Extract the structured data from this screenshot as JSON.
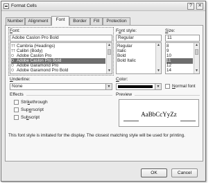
{
  "window": {
    "title": "Format Cells",
    "help_label": "?",
    "close_label": "✕",
    "icon": "excel-app-icon"
  },
  "tabs": [
    {
      "label": "Number",
      "active": false
    },
    {
      "label": "Alignment",
      "active": false
    },
    {
      "label": "Font",
      "active": true
    },
    {
      "label": "Border",
      "active": false
    },
    {
      "label": "Fill",
      "active": false
    },
    {
      "label": "Protection",
      "active": false
    }
  ],
  "font": {
    "label_mnemonic": "F",
    "label_rest": "ont:",
    "value": "Adobe Caslon Pro Bold",
    "list": [
      {
        "label": "Cambria (Headings)",
        "icon": "truetype-font-icon",
        "selected": false
      },
      {
        "label": "Calibri (Body)",
        "icon": "truetype-font-icon",
        "selected": false
      },
      {
        "label": "Adobe Caslon Pro",
        "icon": "opentype-font-icon",
        "selected": false
      },
      {
        "label": "Adobe Caslon Pro Bold",
        "icon": "opentype-font-icon",
        "selected": true
      },
      {
        "label": "Adobe Garamond Pro",
        "icon": "opentype-font-icon",
        "selected": false
      },
      {
        "label": "Adobe Garamond Pro Bold",
        "icon": "opentype-font-icon",
        "selected": false
      }
    ]
  },
  "font_style": {
    "label_mnemonic": "o",
    "label_pre": "F",
    "label_rest": "nt style:",
    "value": "Regular",
    "list": [
      {
        "label": "Regular",
        "selected": true
      },
      {
        "label": "Italic",
        "selected": false
      },
      {
        "label": "Bold",
        "selected": false
      },
      {
        "label": "Bold Italic",
        "selected": false
      }
    ]
  },
  "size": {
    "label_mnemonic": "S",
    "label_rest": "ize:",
    "value": "11",
    "list": [
      {
        "label": "8",
        "selected": false
      },
      {
        "label": "9",
        "selected": false
      },
      {
        "label": "10",
        "selected": false
      },
      {
        "label": "11",
        "selected": true
      },
      {
        "label": "12",
        "selected": false
      },
      {
        "label": "14",
        "selected": false
      }
    ]
  },
  "underline": {
    "label_mnemonic": "U",
    "label_rest": "nderline:",
    "value": "None"
  },
  "color": {
    "label_mnemonic": "C",
    "label_rest": "olor:",
    "swatch": "#000000",
    "normal_font_mnemonic": "N",
    "normal_font_rest": "ormal font",
    "normal_font_checked": false
  },
  "effects": {
    "title": "Effects",
    "items": [
      {
        "pre": "Stri",
        "mnemonic": "k",
        "rest": "ethrough",
        "checked": false
      },
      {
        "pre": "Sup",
        "mnemonic": "e",
        "rest": "rscript",
        "checked": false
      },
      {
        "pre": "Su",
        "mnemonic": "b",
        "rest": "script",
        "checked": false
      }
    ]
  },
  "preview": {
    "title": "Preview",
    "sample": "AaBbCcYyZz"
  },
  "note": "This font style is imitated for the display. The closest matching style will be used for printing.",
  "buttons": {
    "ok": "OK",
    "cancel": "Cancel"
  },
  "colors": {
    "dialog_bg": "#e8e8e8",
    "panel_bg": "#f7f7f7",
    "selection": "#6e6e6e"
  }
}
